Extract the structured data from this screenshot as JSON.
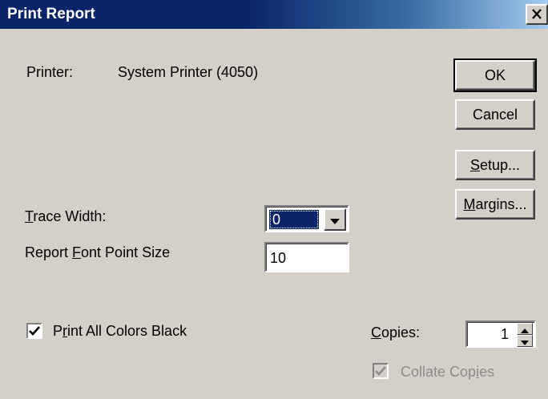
{
  "dialog": {
    "title": "Print Report",
    "close_symbol": "✕"
  },
  "printer": {
    "label": "Printer:",
    "value": "System Printer (4050)"
  },
  "buttons": {
    "ok": "OK",
    "cancel": "Cancel",
    "setup": {
      "mnemonic": "S",
      "rest": "etup..."
    },
    "margins": {
      "mnemonic": "M",
      "rest": "argins..."
    }
  },
  "trace_width": {
    "label_mnemonic": "T",
    "label_rest": "race Width:",
    "selected_value": "0"
  },
  "font_size": {
    "label_pre": "Report ",
    "label_mnemonic": "F",
    "label_rest": "ont Point Size",
    "value": "10"
  },
  "print_black": {
    "checked": true,
    "label_pre": "P",
    "label_mnemonic": "r",
    "label_rest": "int All Colors Black"
  },
  "copies": {
    "label_mnemonic": "C",
    "label_rest": "opies:",
    "value": "1"
  },
  "collate": {
    "checked": true,
    "disabled": true,
    "label_pre": "Collate Cop",
    "label_mnemonic": "i",
    "label_rest": "es"
  },
  "icons": {
    "close": "close-icon",
    "dropdown": "triangle-down-icon",
    "spin_up": "triangle-up-icon",
    "spin_down": "triangle-down-icon",
    "check": "checkmark-icon"
  },
  "colors": {
    "title_bar": "#0a246a",
    "face": "#d4d0c8",
    "selection": "#0a246a",
    "disabled_text": "#8c8c8c"
  }
}
